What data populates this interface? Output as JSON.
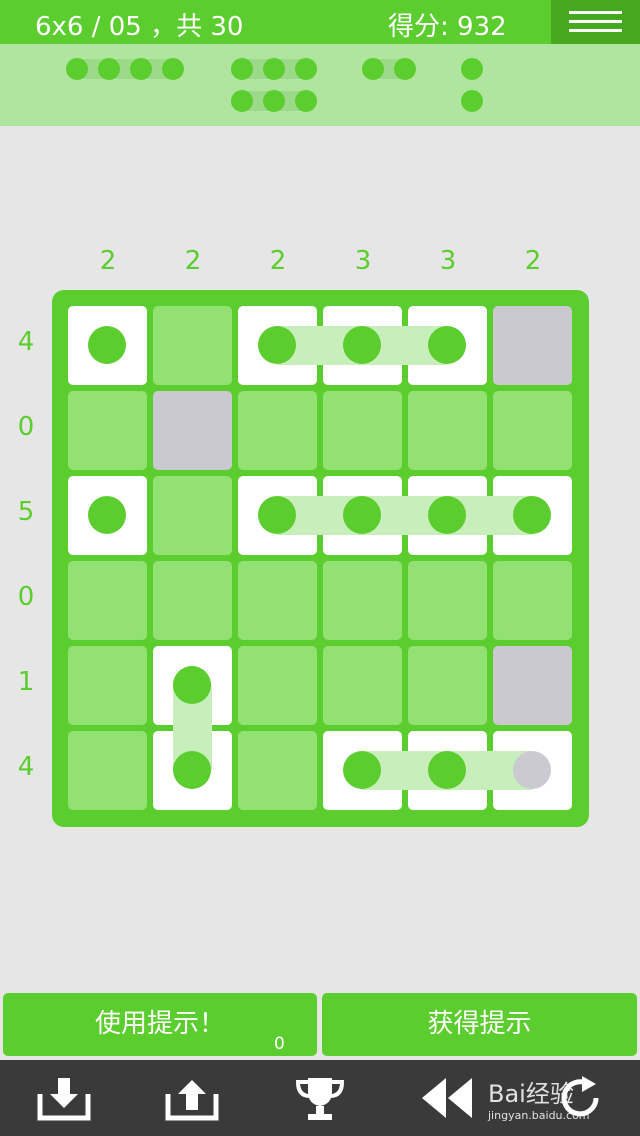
{
  "header": {
    "level_text": "6x6 / 05 ，共 30",
    "score_text": "得分: 932",
    "menu_icon": "hamburger-icon"
  },
  "fleet": [
    {
      "size": 4
    },
    {
      "size": 3
    },
    {
      "size": 3
    },
    {
      "size": 2
    },
    {
      "size": 1
    },
    {
      "size": 1
    }
  ],
  "board": {
    "size": 6,
    "column_clues": [
      "2",
      "2",
      "2",
      "3",
      "3",
      "2"
    ],
    "row_clues": [
      "4",
      "0",
      "5",
      "0",
      "1",
      "4"
    ],
    "cells": [
      [
        "ship",
        "water",
        "ship",
        "ship",
        "ship",
        "rock"
      ],
      [
        "water",
        "rock",
        "water",
        "water",
        "water",
        "water"
      ],
      [
        "ship",
        "water",
        "ship",
        "ship",
        "ship",
        "ship"
      ],
      [
        "water",
        "water",
        "water",
        "water",
        "water",
        "water"
      ],
      [
        "water",
        "ship",
        "water",
        "water",
        "water",
        "rock"
      ],
      [
        "water",
        "ship",
        "water",
        "ship",
        "ship",
        "ship-grey"
      ]
    ]
  },
  "actions": {
    "use_hint_label": "使用提示！",
    "hint_count": "0",
    "get_hint_label": "获得提示"
  },
  "toolbar": {
    "icons": [
      "download-icon",
      "upload-icon",
      "trophy-icon",
      "rewind-icon",
      "refresh-icon"
    ]
  },
  "watermark": {
    "text": "Bai经验",
    "sub": "jingyan.baidu.com"
  },
  "colors": {
    "primary": "#5ccd2e",
    "dark_green": "#45a81f",
    "light_cell": "#93e173",
    "rock": "#c9c9cf",
    "toolbar_bg": "#3a3a3a"
  }
}
